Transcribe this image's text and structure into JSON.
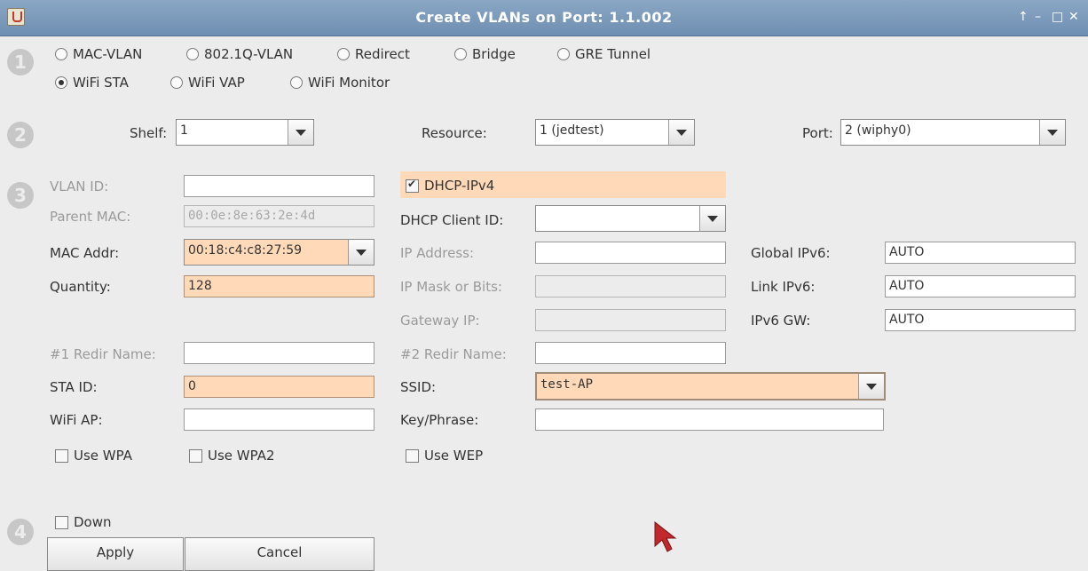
{
  "window": {
    "title": "Create VLANs on Port: 1.1.002"
  },
  "steps": {
    "s1": "1",
    "s2": "2",
    "s3": "3",
    "s4": "4"
  },
  "type_radios": [
    {
      "label": "MAC-VLAN",
      "selected": false
    },
    {
      "label": "802.1Q-VLAN",
      "selected": false
    },
    {
      "label": "Redirect",
      "selected": false
    },
    {
      "label": "Bridge",
      "selected": false
    },
    {
      "label": "GRE Tunnel",
      "selected": false
    },
    {
      "label": "WiFi STA",
      "selected": true
    },
    {
      "label": "WiFi VAP",
      "selected": false
    },
    {
      "label": "WiFi Monitor",
      "selected": false
    }
  ],
  "location": {
    "shelf_label": "Shelf:",
    "shelf_value": "1",
    "resource_label": "Resource:",
    "resource_value": "1 (jedtest)",
    "port_label": "Port:",
    "port_value": "2 (wiphy0)"
  },
  "left": {
    "vlan_id_label": "VLAN ID:",
    "vlan_id_value": "",
    "parent_mac_label": "Parent MAC:",
    "parent_mac_value": "00:0e:8e:63:2e:4d",
    "mac_addr_label": "MAC Addr:",
    "mac_addr_value": "00:18:c4:c8:27:59",
    "quantity_label": "Quantity:",
    "quantity_value": "128",
    "redir1_label": "#1 Redir Name:",
    "redir1_value": "",
    "sta_id_label": "STA ID:",
    "sta_id_value": "0",
    "wifi_ap_label": "WiFi AP:",
    "wifi_ap_value": "",
    "use_wpa": "Use WPA",
    "use_wpa2": "Use WPA2"
  },
  "middle": {
    "dhcp_ipv4": "DHCP-IPv4",
    "dhcp_ipv4_checked": true,
    "dhcp_client_id_label": "DHCP Client ID:",
    "dhcp_client_id_value": "",
    "ip_address_label": "IP Address:",
    "ip_address_value": "",
    "ip_mask_label": "IP Mask or Bits:",
    "ip_mask_value": "",
    "gateway_label": "Gateway IP:",
    "gateway_value": "",
    "redir2_label": "#2 Redir Name:",
    "redir2_value": "",
    "ssid_label": "SSID:",
    "ssid_value": "test-AP",
    "key_label": "Key/Phrase:",
    "key_value": "",
    "use_wep": "Use WEP"
  },
  "right": {
    "global_ipv6_label": "Global IPv6:",
    "global_ipv6_value": "AUTO",
    "link_ipv6_label": "Link IPv6:",
    "link_ipv6_value": "AUTO",
    "ipv6_gw_label": "IPv6 GW:",
    "ipv6_gw_value": "AUTO"
  },
  "bottom": {
    "down_label": "Down",
    "apply_label": "Apply",
    "cancel_label": "Cancel"
  },
  "colors": {
    "highlight": "#ffd9b8",
    "titlebar": "#7b98b9"
  }
}
